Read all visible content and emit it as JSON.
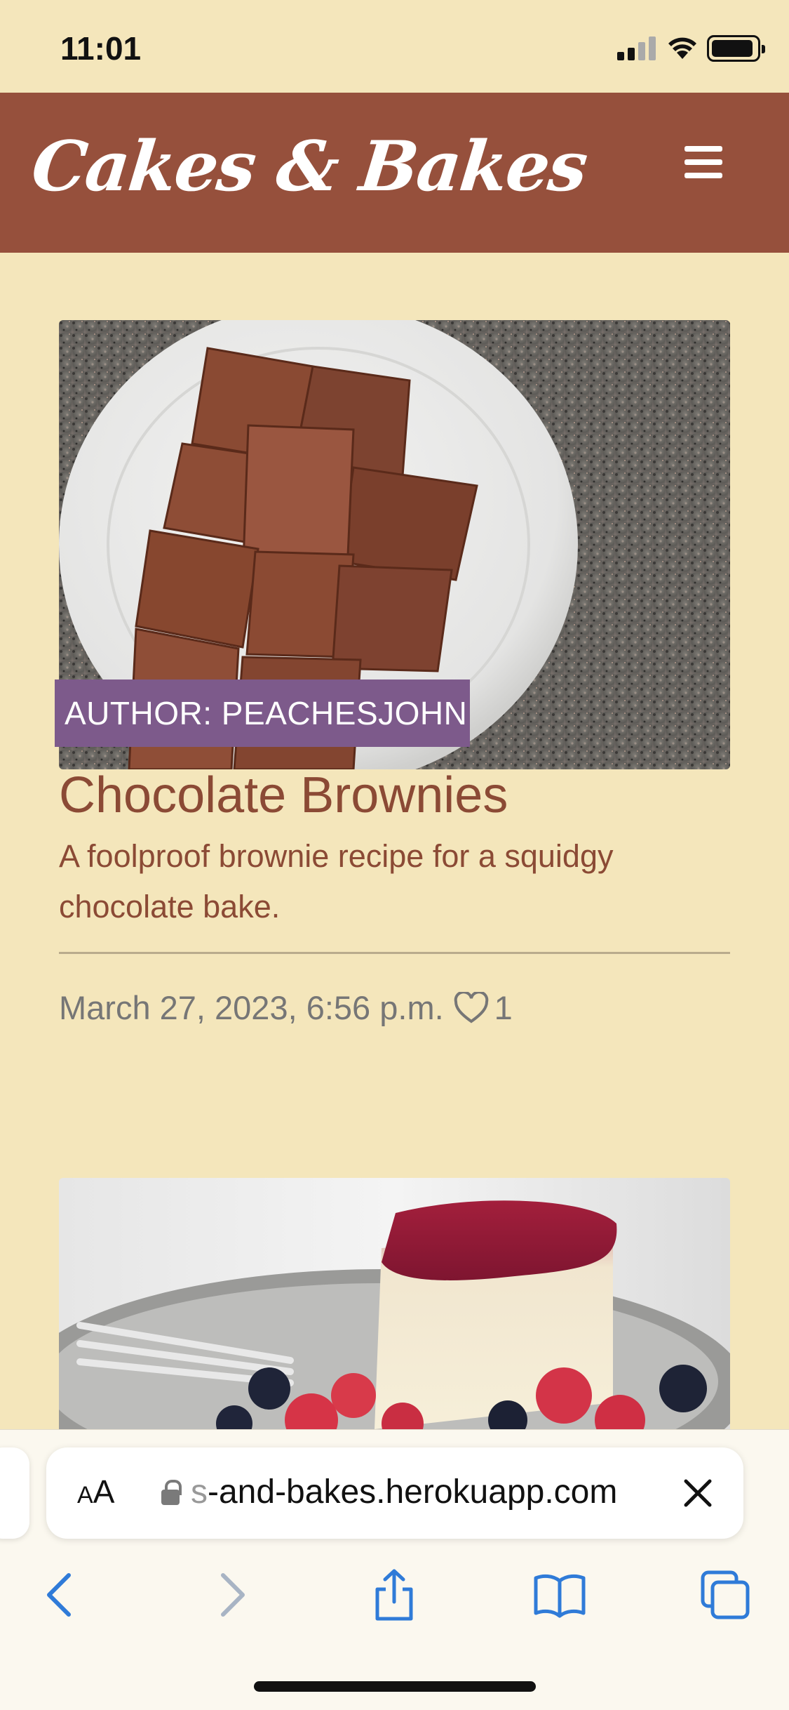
{
  "status_bar": {
    "time": "11:01"
  },
  "header": {
    "brand": "Cakes & Bakes",
    "menu_icon": "hamburger-icon"
  },
  "posts": [
    {
      "author_label": "AUTHOR: PEACHESJOHN",
      "title": "Chocolate Brownies",
      "excerpt": "A foolproof brownie recipe for a squidgy chocolate bake.",
      "date": "March 27, 2023, 6:56 p.m.",
      "likes": "1",
      "image": "brownies-photo"
    },
    {
      "image": "cheesecake-photo"
    }
  ],
  "browser": {
    "text_size_small": "A",
    "text_size_large": "A",
    "url_fade": "s",
    "url": "-and-bakes.herokuapp.com",
    "icons": [
      "back-icon",
      "forward-icon",
      "share-icon",
      "bookmarks-icon",
      "tabs-icon"
    ]
  },
  "colors": {
    "background": "#f4e6bb",
    "header": "#96503c",
    "badge": "#7d5a8b",
    "title": "#8b4a35",
    "meta": "#767676"
  }
}
